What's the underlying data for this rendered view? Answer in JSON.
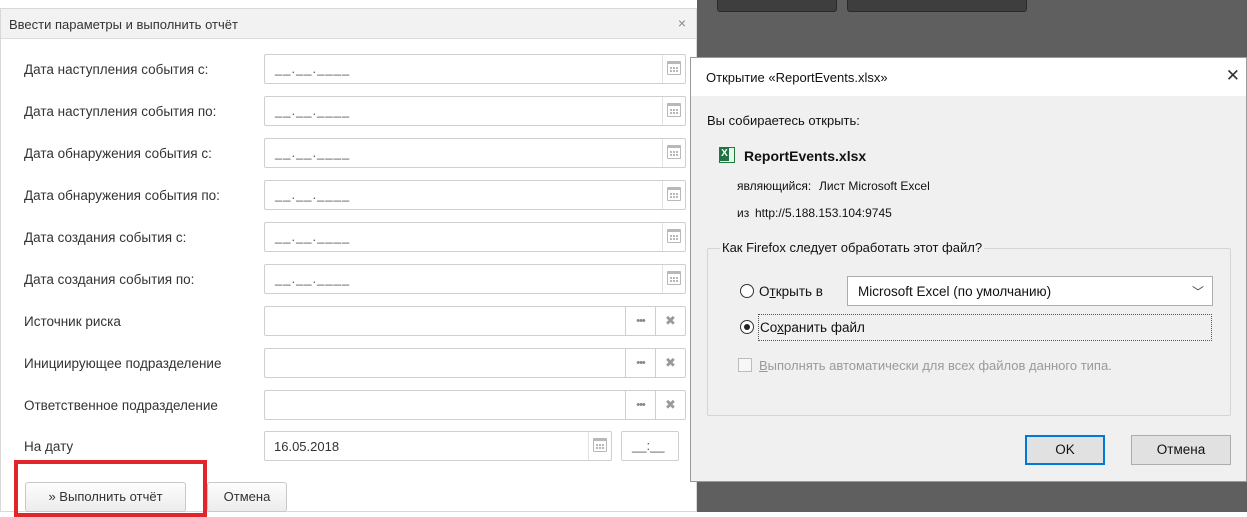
{
  "report_dialog": {
    "title": "Ввести параметры и выполнить отчёт",
    "close_glyph": "×",
    "date_rows": [
      {
        "label": "Дата наступления события с:",
        "value": "__.__.____"
      },
      {
        "label": "Дата наступления события по:",
        "value": "__.__.____"
      },
      {
        "label": "Дата обнаружения события с:",
        "value": "__.__.____"
      },
      {
        "label": "Дата обнаружения события по:",
        "value": "__.__.____"
      },
      {
        "label": "Дата создания события с:",
        "value": "__.__.____"
      },
      {
        "label": "Дата создания события по:",
        "value": "__.__.____"
      }
    ],
    "lookup_rows": [
      {
        "label": "Источник риска",
        "value": ""
      },
      {
        "label": "Инициирующее подразделение",
        "value": ""
      },
      {
        "label": "Ответственное подразделение",
        "value": ""
      }
    ],
    "lookup_dots": "•••",
    "lookup_clear": "✖",
    "on_date": {
      "label": "На дату",
      "value": "16.05.2018",
      "time_value": "__:__"
    },
    "run_button": "» Выполнить отчёт",
    "cancel_button": "Отмена",
    "highlight_color": "#e0262b"
  },
  "firefox_dialog": {
    "title": "Открытие «ReportEvents.xlsx»",
    "close_glyph": "✕",
    "intro": "Вы собираетесь открыть:",
    "file_name": "ReportEvents.xlsx",
    "type_prefix": "являющийся:",
    "type_value": "Лист Microsoft Excel",
    "from_prefix": "из",
    "from_value": "http://5.188.153.104:9745",
    "question": "Как Firefox следует обработать этот файл?",
    "open_with": {
      "label_pre": "О",
      "label_accel": "т",
      "label_post": "крыть в",
      "checked": false
    },
    "open_app": "Microsoft Excel (по умолчанию)",
    "save_file": {
      "label_pre": "Со",
      "label_accel": "х",
      "label_post": "ранить файл",
      "checked": true
    },
    "auto": {
      "label_pre": "",
      "label_accel": "В",
      "label_post": "ыполнять автоматически для всех файлов данного типа.",
      "checked": false
    },
    "ok_button": "OK",
    "cancel_button": "Отмена",
    "ok_border_color": "#0078d7"
  }
}
